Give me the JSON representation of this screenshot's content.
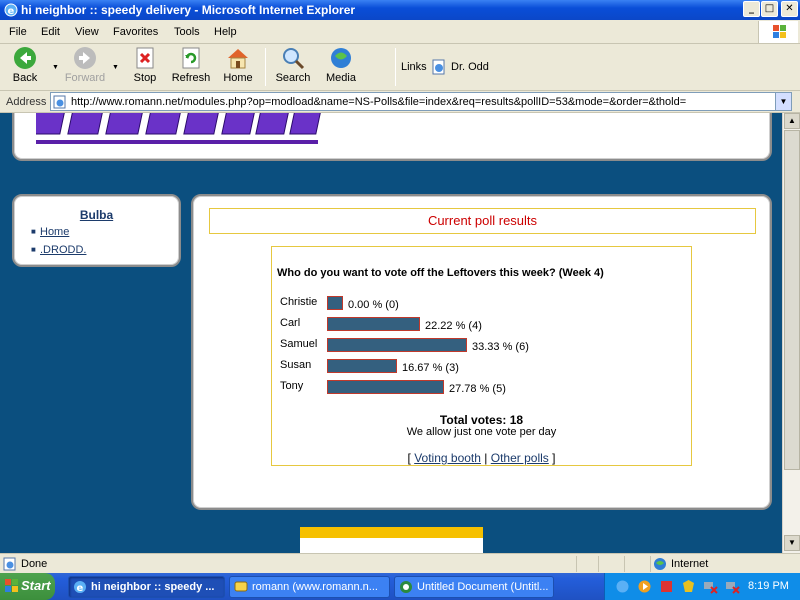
{
  "window": {
    "title": "hi neighbor :: speedy delivery - Microsoft Internet Explorer",
    "min_glyph": "_",
    "max_glyph": "□",
    "close_glyph": "✕"
  },
  "menu": [
    "File",
    "Edit",
    "View",
    "Favorites",
    "Tools",
    "Help"
  ],
  "toolbar": {
    "back": "Back",
    "forward": "Forward",
    "stop": "Stop",
    "refresh": "Refresh",
    "home": "Home",
    "search": "Search",
    "media": "Media",
    "links_label": "Links",
    "link_item": "Dr. Odd"
  },
  "address": {
    "label": "Address",
    "url": "http://www.romann.net/modules.php?op=modload&name=NS-Polls&file=index&req=results&pollID=53&mode=&order=&thold="
  },
  "sidebar": {
    "title": "Bulba",
    "items": [
      {
        "label": "Home"
      },
      {
        "label": ".DRODD."
      }
    ]
  },
  "poll": {
    "header": "Current poll results",
    "question": "Who do you want to vote off the Leftovers this week? (Week 4)",
    "options": [
      {
        "name": "Christie",
        "percent": 0.0,
        "votes": 0,
        "label": "0.00 % (0)"
      },
      {
        "name": "Carl",
        "percent": 22.22,
        "votes": 4,
        "label": "22.22 % (4)"
      },
      {
        "name": "Samuel",
        "percent": 33.33,
        "votes": 6,
        "label": "33.33 % (6)"
      },
      {
        "name": "Susan",
        "percent": 16.67,
        "votes": 3,
        "label": "16.67 % (3)"
      },
      {
        "name": "Tony",
        "percent": 27.78,
        "votes": 5,
        "label": "27.78 % (5)"
      }
    ],
    "total_votes": "Total votes: 18",
    "note": "We allow just one vote per day",
    "voting_booth": "Voting booth",
    "other_polls": "Other polls",
    "bracket_open": "[",
    "separator": "|",
    "bracket_close": "]"
  },
  "status": {
    "text": "Done",
    "zone": "Internet"
  },
  "taskbar": {
    "start": "Start",
    "tasks": [
      {
        "label": "hi neighbor :: speedy ..."
      },
      {
        "label": "romann (www.romann.n..."
      },
      {
        "label": "Untitled Document (Untitl..."
      }
    ],
    "clock": "8:19 PM"
  },
  "colors": {
    "page_background": "#0b4f7f",
    "bar_fill": "#34607f",
    "poll_header": "#cc0000",
    "link": "#1c3b6b"
  }
}
